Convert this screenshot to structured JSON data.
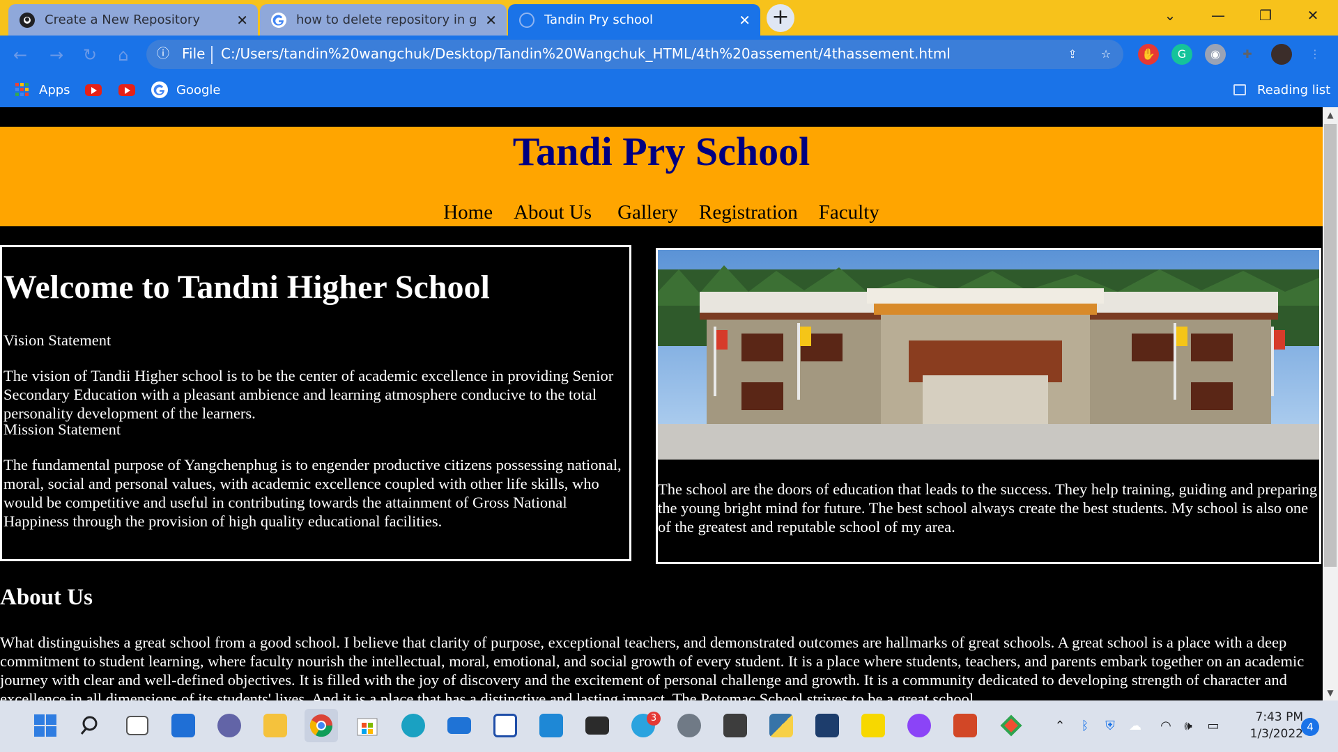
{
  "browser": {
    "tabs": [
      {
        "title": "Create a New Repository",
        "favicon": "github-icon"
      },
      {
        "title": "how to delete repository in githu",
        "favicon": "google-icon"
      },
      {
        "title": "Tandin Pry school",
        "favicon": "globe-icon",
        "active": true
      }
    ],
    "omnibox": {
      "scheme_label": "File",
      "url": "C:/Users/tandin%20wangchuk/Desktop/Tandin%20Wangchuk_HTML/4th%20assement/4thassement.html"
    },
    "bookmarks": [
      {
        "label": "Apps",
        "icon": "apps-grid-icon"
      },
      {
        "label": "",
        "icon": "youtube-icon"
      },
      {
        "label": "",
        "icon": "youtube-icon"
      },
      {
        "label": "Google",
        "icon": "google-icon"
      }
    ],
    "reading_list_label": "Reading list"
  },
  "page": {
    "site_title": "Tandi Pry School",
    "nav": [
      "Home",
      "About Us",
      "Gallery",
      "Registration",
      "Faculty"
    ],
    "welcome": {
      "heading": "Welcome to Tandni Higher School",
      "vision_label": "Vision Statement",
      "vision_text": "The vision of Tandii Higher school is to be the center of academic excellence in providing Senior Secondary Education with a pleasant ambience and learning atmosphere conducive to the total personality development of the learners.",
      "mission_label": "Mission Statement",
      "mission_text": "The fundamental purpose of Yangchenphug is to engender productive citizens possessing national, moral, social and personal values, with academic excellence coupled with other life skills, who would be competitive and useful in contributing towards the attainment of Gross National Happiness through the provision of high quality educational facilities."
    },
    "photo_caption": "The school are the doors of education that leads to the success. They help training, guiding and preparing the young bright mind for future. The best school always create the best students. My school is also one of the greatest and reputable school of my area.",
    "about": {
      "heading": "About Us",
      "text": "What distinguishes a great school from a good school. I believe that clarity of purpose, exceptional teachers, and demonstrated outcomes are hallmarks of great schools. A great school is a place with a deep commitment to student learning, where faculty nourish the intellectual, moral, emotional, and social growth of every student. It is a place where students, teachers, and parents embark together on an academic journey with clear and well-defined objectives. It is filled with the joy of discovery and the excitement of personal challenge and growth. It is a community dedicated to developing strength of character and excellence in all dimensions of its students' lives. And it is a place that has a distinctive and lasting impact. The Potomac School strives to be a great school."
    }
  },
  "taskbar": {
    "apps": [
      "windows-start-icon",
      "search-icon",
      "task-view-icon",
      "widgets-icon",
      "teams-chat-icon",
      "file-explorer-icon",
      "chrome-icon",
      "microsoft-store-icon",
      "edge-icon",
      "mail-icon",
      "sticky-app-icon",
      "vscode-icon",
      "terminal-icon",
      "telegram-icon",
      "settings-icon",
      "sublime-icon",
      "python-icon",
      "unknown-app-icon",
      "sticky-notes-icon",
      "messenger-icon",
      "powerpoint-icon",
      "git-icon"
    ],
    "telegram_badge": "3",
    "time": "7:43 PM",
    "date": "1/3/2022",
    "notification_count": "4"
  }
}
